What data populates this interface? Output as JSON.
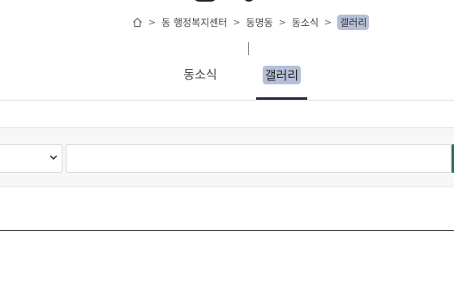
{
  "breadcrumb": {
    "home_icon": "home-icon",
    "separator": ">",
    "items": [
      {
        "label": "동 행정복지센터"
      },
      {
        "label": "동명동"
      },
      {
        "label": "동소식"
      },
      {
        "label": "갤러리"
      }
    ]
  },
  "tabs": [
    {
      "label": "동소식",
      "active": false
    },
    {
      "label": "갤러리",
      "active": true
    }
  ],
  "search": {
    "select_value": "",
    "input_value": "",
    "placeholder": ""
  },
  "colors": {
    "highlight": "#b5c0d8",
    "active_tab_underline": "#1f2a3c",
    "search_button": "#2e7060"
  }
}
